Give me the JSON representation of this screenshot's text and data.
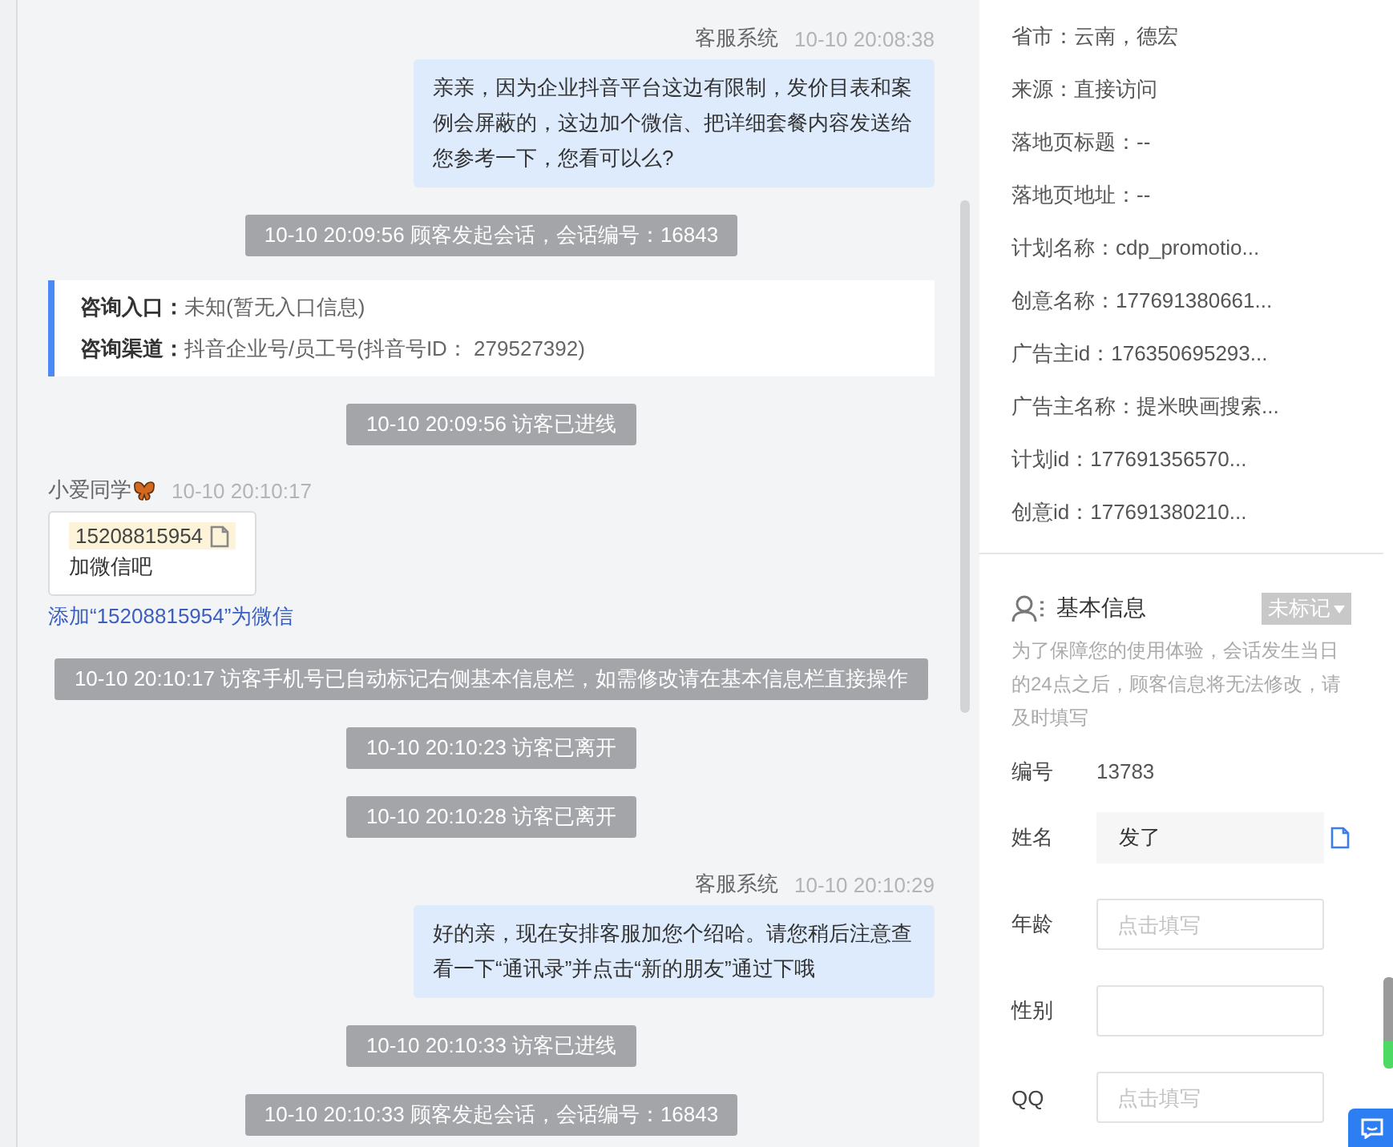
{
  "chat": {
    "messages": [
      {
        "kind": "agent",
        "sender": "客服系统",
        "time": "10-10 20:08:38",
        "text": "亲亲，因为企业抖音平台这边有限制，发价目表和案例会屏蔽的，这边加个微信、把详细套餐内容发送给您参考一下，您看可以么?"
      },
      {
        "kind": "notice",
        "text": "10-10 20:09:56 顾客发起会话，会话编号：16843"
      },
      {
        "kind": "source",
        "rows": [
          {
            "label": "咨询入口：",
            "value": "未知(暂无入口信息)"
          },
          {
            "label": "咨询渠道：",
            "value": "抖音企业号/员工号(抖音号ID： 279527392)"
          }
        ]
      },
      {
        "kind": "notice",
        "text": "10-10 20:09:56 访客已进线"
      },
      {
        "kind": "visitor",
        "sender": "小爱同学",
        "time": "10-10 20:10:17",
        "phone": "15208815954",
        "text": "加微信吧",
        "link": "添加“15208815954”为微信"
      },
      {
        "kind": "notice",
        "text": "10-10 20:10:17 访客手机号已自动标记右侧基本信息栏，如需修改请在基本信息栏直接操作"
      },
      {
        "kind": "notice",
        "text": "10-10 20:10:23 访客已离开"
      },
      {
        "kind": "notice",
        "text": "10-10 20:10:28 访客已离开"
      },
      {
        "kind": "agent",
        "sender": "客服系统",
        "time": "10-10 20:10:29",
        "text": "好的亲，现在安排客服加您个绍哈。请您稍后注意查看一下“通讯录”并点击“新的朋友”通过下哦"
      },
      {
        "kind": "notice",
        "text": "10-10 20:10:33 访客已进线"
      },
      {
        "kind": "notice",
        "text": "10-10 20:10:33 顾客发起会话，会话编号：16843"
      }
    ]
  },
  "visitor_info": [
    "省市：云南，德宏",
    "来源：直接访问",
    "落地页标题：--",
    "落地页地址：--",
    "计划名称：cdp_promotio...",
    "创意名称：177691380661...",
    "广告主id：176350695293...",
    "广告主名称：提米映画搜索...",
    "计划id：177691356570...",
    "创意id：177691380210..."
  ],
  "basic_info": {
    "title": "基本信息",
    "tag": "未标记",
    "notice": "为了保障您的使用体验，会话发生当日的24点之后，顾客信息将无法修改，请及时填写",
    "fields": [
      {
        "kind": "text",
        "label": "编号",
        "value": "13783"
      },
      {
        "kind": "readonly",
        "label": "姓名",
        "value": "发了"
      },
      {
        "kind": "input",
        "label": "年龄",
        "placeholder": "点击填写"
      },
      {
        "kind": "input",
        "label": "性别"
      },
      {
        "kind": "input",
        "label": "QQ",
        "placeholder": "点击填写"
      }
    ]
  }
}
